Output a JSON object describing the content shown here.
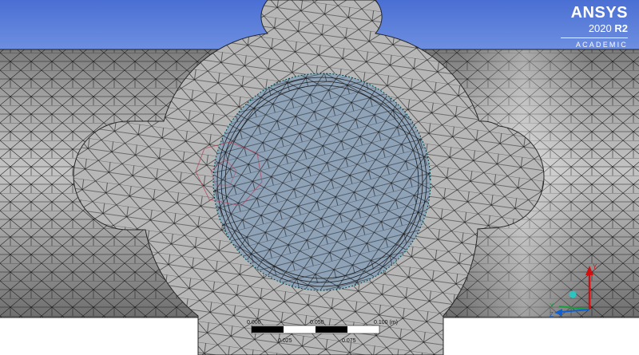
{
  "logo": {
    "brand": "ANSYS",
    "version_year": "2020",
    "version_release": "R2",
    "edition": "ACADEMIC"
  },
  "scale_bar": {
    "ticks_top": [
      "0.000",
      "0.050",
      "0.100 (m)"
    ],
    "ticks_bottom": [
      "0.025",
      "0.075"
    ]
  },
  "triad": {
    "x_label": "X",
    "y_label": "Y",
    "z_label": "Z"
  },
  "colors": {
    "background_top": "#4a6fd4",
    "background_bottom": "#ffffff",
    "mesh_face": "#b6b6b6",
    "mesh_edge": "#1a1a1a",
    "selected_face": "#8ea2b8",
    "axis_x": "#d01010",
    "axis_y": "#1060d0",
    "axis_z": "#1c9e3c"
  }
}
